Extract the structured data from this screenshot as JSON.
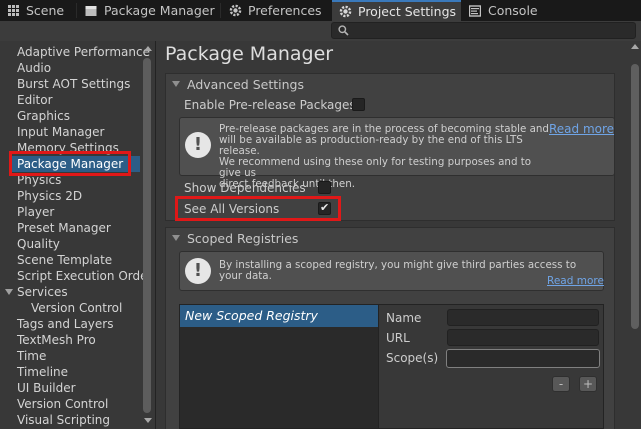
{
  "tabs": [
    {
      "label": "Scene",
      "icon": "grid-icon"
    },
    {
      "label": "Package Manager",
      "icon": "package-icon"
    },
    {
      "label": "Preferences",
      "icon": "gear-icon"
    },
    {
      "label": "Project Settings",
      "icon": "gear-icon",
      "active": true
    },
    {
      "label": "Console",
      "icon": "console-icon"
    }
  ],
  "search": {
    "placeholder": ""
  },
  "sidebar": {
    "items": [
      {
        "label": "Adaptive Performance"
      },
      {
        "label": "Audio"
      },
      {
        "label": "Burst AOT Settings"
      },
      {
        "label": "Editor"
      },
      {
        "label": "Graphics"
      },
      {
        "label": "Input Manager"
      },
      {
        "label": "Memory Settings"
      },
      {
        "label": "Package Manager",
        "selected": true
      },
      {
        "label": "Physics"
      },
      {
        "label": "Physics 2D"
      },
      {
        "label": "Player"
      },
      {
        "label": "Preset Manager"
      },
      {
        "label": "Quality"
      },
      {
        "label": "Scene Template"
      },
      {
        "label": "Script Execution Orde"
      },
      {
        "label": "Services",
        "expandable": true
      },
      {
        "label": "Version Control",
        "child": true
      },
      {
        "label": "Tags and Layers"
      },
      {
        "label": "TextMesh Pro"
      },
      {
        "label": "Time"
      },
      {
        "label": "Timeline"
      },
      {
        "label": "UI Builder"
      },
      {
        "label": "Version Control"
      },
      {
        "label": "Visual Scripting"
      }
    ]
  },
  "main": {
    "title": "Package Manager",
    "advanced": {
      "header": "Advanced Settings",
      "enable_prerelease_label": "Enable Pre-release Packages",
      "enable_prerelease_checked": false,
      "help_text": "Pre-release packages are in the process of becoming stable and\nwill be available as production-ready by the end of this LTS release.\nWe recommend using these only for testing purposes and to give us\ndirect feedback until then.",
      "read_more": "Read more",
      "show_dependencies_label": "Show Dependencies",
      "show_dependencies_checked": false,
      "see_all_versions_label": "See All Versions",
      "see_all_versions_checked": true
    },
    "scoped": {
      "header": "Scoped Registries",
      "help_text": "By installing a scoped registry, you might give third parties access to your data.",
      "read_more": "Read more",
      "registry_item": "New Scoped Registry",
      "name_label": "Name",
      "url_label": "URL",
      "scopes_label": "Scope(s)",
      "name_value": "",
      "url_value": "",
      "scopes_value": "",
      "remove_label": "-",
      "add_label": "+"
    }
  },
  "colors": {
    "accent": "#2c5d87",
    "highlight": "#e01818",
    "link": "#6fa4e6"
  }
}
